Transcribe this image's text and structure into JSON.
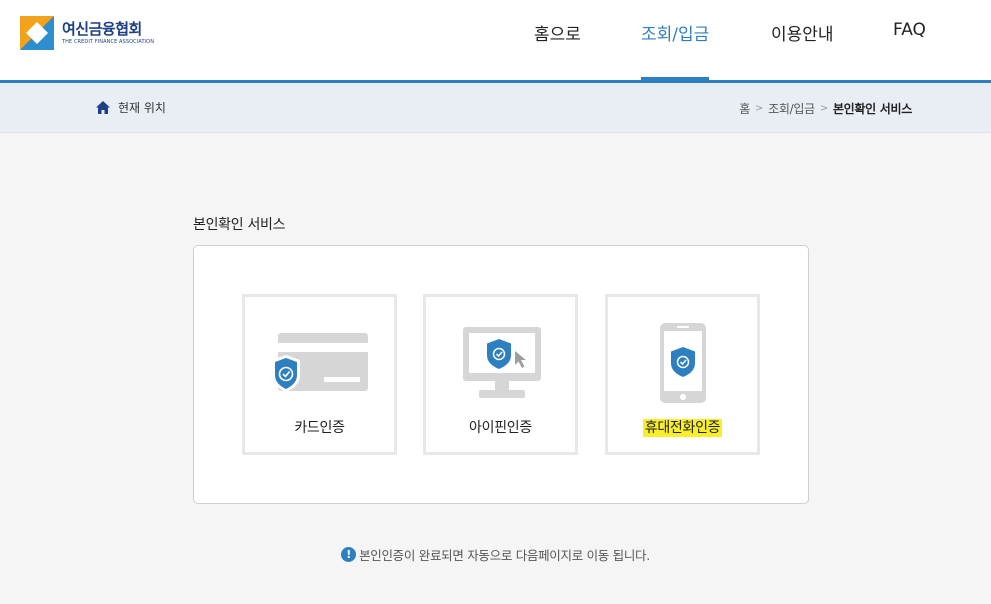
{
  "header": {
    "logo_name": "여신금융협회",
    "logo_sub": "THE CREDIT FINANCE ASSOCIATION",
    "nav": [
      {
        "label": "홈으로",
        "active": false
      },
      {
        "label": "조회/입금",
        "active": true
      },
      {
        "label": "이용안내",
        "active": false
      },
      {
        "label": "FAQ",
        "active": false
      }
    ]
  },
  "breadcrumb": {
    "location_label": "현재 위치",
    "trail": [
      "홈",
      "조회/입금",
      "본인확인 서비스"
    ]
  },
  "main": {
    "title": "본인확인 서비스",
    "options": [
      {
        "label": "카드인증",
        "icon": "credit-card-shield-icon"
      },
      {
        "label": "아이핀인증",
        "icon": "monitor-shield-icon"
      },
      {
        "label": "휴대전화인증",
        "icon": "mobile-shield-icon",
        "highlighted": true
      }
    ],
    "notice_icon": "!",
    "notice": "본인인증이 완료되면 자동으로 다음페이지로 이동 됩니다."
  },
  "colors": {
    "accent": "#2e7fc0",
    "highlight": "#f8ef2a",
    "icon_gray": "#d6d6d6"
  }
}
